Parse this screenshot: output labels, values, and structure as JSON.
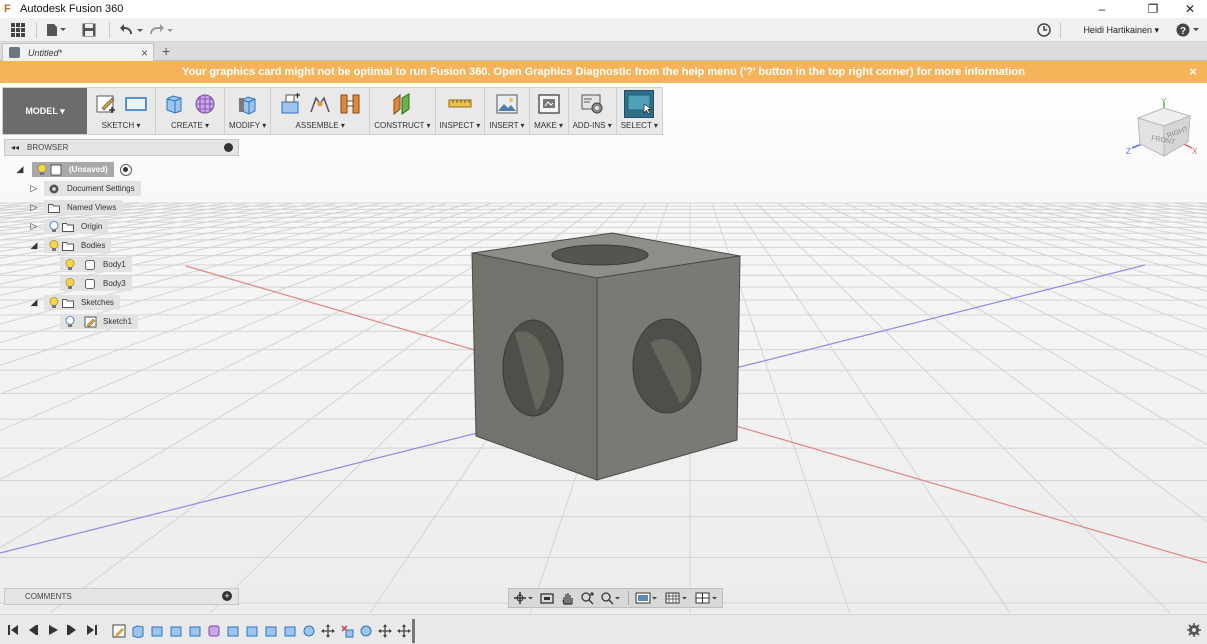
{
  "window": {
    "app_title": "Autodesk Fusion 360",
    "logo_glyph": "F",
    "minimize_glyph": "–",
    "restore_glyph": "❐",
    "close_glyph": "✕"
  },
  "qat": {
    "icons": [
      "grid-icon",
      "file-icon",
      "save-icon",
      "undo-icon",
      "redo-icon"
    ],
    "user_name": "Heidi Hartikainen ▾",
    "help_glyph": "?"
  },
  "tabs": [
    {
      "label": "Untitled*",
      "close_glyph": "×"
    }
  ],
  "new_tab_glyph": "+",
  "banner": {
    "message": "Your graphics card might not be optimal to run Fusion 360. Open Graphics Diagnostic from the help menu ('?' button in the top right corner) for more information",
    "close_glyph": "×",
    "color": "#f6b35a"
  },
  "toolbar": {
    "workspace": "MODEL ▾",
    "groups": [
      {
        "label": "SKETCH ▾",
        "tools": [
          "create-sketch-icon",
          "rectangle-icon"
        ]
      },
      {
        "label": "CREATE ▾",
        "tools": [
          "extrude-box-icon",
          "sphere-form-icon"
        ]
      },
      {
        "label": "MODIFY ▾",
        "tools": [
          "press-pull-icon"
        ]
      },
      {
        "label": "ASSEMBLE ▾",
        "tools": [
          "new-component-icon",
          "joint-icon",
          "as-built-joint-icon"
        ]
      },
      {
        "label": "CONSTRUCT ▾",
        "tools": [
          "offset-plane-icon"
        ]
      },
      {
        "label": "INSPECT ▾",
        "tools": [
          "measure-icon"
        ]
      },
      {
        "label": "INSERT ▾",
        "tools": [
          "insert-image-icon"
        ]
      },
      {
        "label": "MAKE ▾",
        "tools": [
          "3d-print-icon"
        ]
      },
      {
        "label": "ADD-INS ▾",
        "tools": [
          "scripts-addins-icon"
        ]
      },
      {
        "label": "SELECT ▾",
        "tools": [
          "select-icon"
        ]
      }
    ]
  },
  "browser": {
    "title": "BROWSER",
    "collapse_glyph": "◂◂",
    "nodes": [
      {
        "label": "(Unsaved)",
        "expander": "◢",
        "icon": "document-icon",
        "bulb": true
      },
      {
        "label": "Document Settings",
        "expander": "▷",
        "icon": "gear-icon",
        "bulb": false
      },
      {
        "label": "Named Views",
        "expander": "▷",
        "icon": "folder-icon",
        "bulb": false
      },
      {
        "label": "Origin",
        "expander": "▷",
        "icon": "folder-icon",
        "bulb": true
      },
      {
        "label": "Bodies",
        "expander": "◢",
        "icon": "folder-icon",
        "bulb": true
      },
      {
        "label": "Body1",
        "expander": "",
        "icon": "body-icon",
        "bulb": true
      },
      {
        "label": "Body3",
        "expander": "",
        "icon": "body-icon",
        "bulb": true
      },
      {
        "label": "Sketches",
        "expander": "◢",
        "icon": "folder-icon",
        "bulb": true
      },
      {
        "label": "Sketch1",
        "expander": "",
        "icon": "sketch-icon",
        "bulb": true
      }
    ]
  },
  "viewcube": {
    "front_label": "FRONT",
    "right_label": "RIGHT",
    "x_label": "X",
    "y_label": "Y",
    "z_label": "Z"
  },
  "comments": {
    "title": "COMMENTS",
    "add_glyph": "+"
  },
  "navbar": {
    "tools": [
      "orbit-icon",
      "look-at-icon",
      "pan-icon",
      "zoom-icon",
      "fit-icon",
      "display-settings-icon",
      "grid-settings-icon",
      "viewports-icon"
    ]
  },
  "timeline": {
    "controls": [
      "first-icon",
      "previous-icon",
      "play-icon",
      "next-icon",
      "last-icon"
    ],
    "features": [
      "sketch-feature",
      "extrude-feature",
      "box-feature",
      "box-feature",
      "box-feature",
      "form-feature",
      "box-feature",
      "box-feature",
      "box-feature",
      "box-feature",
      "hole-feature",
      "move-feature",
      "delete-feature",
      "hole-feature",
      "move-feature",
      "move-feature"
    ]
  },
  "colors": {
    "accent_blue": "#2b73c2",
    "body_gray": "#7a7a74",
    "select_green": "#2d6f8a"
  }
}
